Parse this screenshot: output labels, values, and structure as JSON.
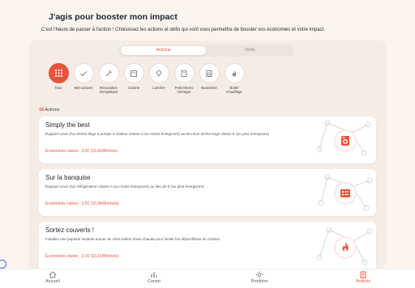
{
  "header": {
    "title": "J'agis pour booster mon impact",
    "subtitle": "C'est l'heure de passer à l'action ! Choisissez les actions et défis qui vont vous permettre de booster vos économies et votre impact."
  },
  "tabs": [
    {
      "label": "Actions",
      "active": true
    },
    {
      "label": "Défis",
      "active": false
    }
  ],
  "categories": [
    {
      "label": "Tous",
      "icon": "grid-icon",
      "active": true
    },
    {
      "label": "Mes actions",
      "icon": "check-icon"
    },
    {
      "label": "Rénovation énergétique",
      "icon": "tools-icon"
    },
    {
      "label": "Cuisine",
      "icon": "stove-icon"
    },
    {
      "label": "Lumière",
      "icon": "bulb-icon"
    },
    {
      "label": "Petit électro ménager",
      "icon": "appliance-icon"
    },
    {
      "label": "Buanderie",
      "icon": "washing-machine-icon"
    },
    {
      "label": "Boiler Chauffage",
      "icon": "flame-icon"
    }
  ],
  "count": {
    "number": "18",
    "label": "Actions"
  },
  "cards": [
    {
      "title": "Simply the best",
      "description": "Équipez-vous d'un sèche-linge à pompe à chaleur classe A (ou moins énergivore) au lieu d'un sèche-linge classe E (ou plus énergivore)",
      "savings": "Économies visées : 3,2€ (15,6kWh/mois",
      "icon": "dryer-icon"
    },
    {
      "title": "Sur la banquise",
      "description": "Équipez-vous d'un réfrigérateur classe A (ou moins énergivore) au lieu de E (ou plus énergivore)",
      "savings": "Économies visées : 3,5€ (33,3kWh/mois)",
      "icon": "fridge-icon"
    },
    {
      "title": "Sortez couverts !",
      "description": "Installez une jaquette isolante autour de votre ballon d'eau chaude pour limiter les déperditions de chaleur",
      "savings": "Économies visées : 2,1€ (10,1kWh/mois)",
      "icon": "flame-icon"
    }
  ],
  "nav": [
    {
      "label": "Accueil",
      "icon": "home-icon"
    },
    {
      "label": "Conso",
      "icon": "chart-icon"
    },
    {
      "label": "Produire",
      "icon": "sun-icon"
    },
    {
      "label": "Actions",
      "icon": "clipboard-icon",
      "active": true
    }
  ],
  "colors": {
    "accent": "#e8533a",
    "background": "#fbf3ee"
  }
}
